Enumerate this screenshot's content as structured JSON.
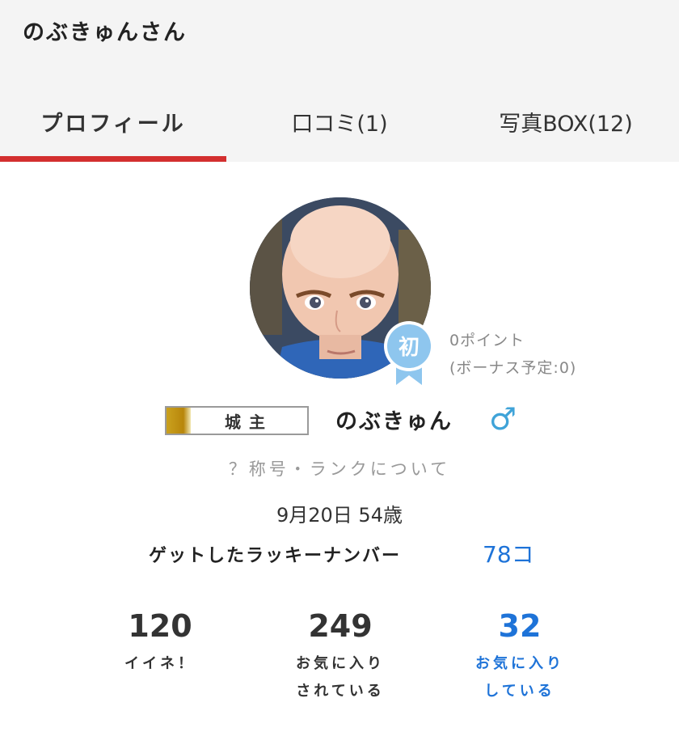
{
  "header": {
    "title": "のぶきゅんさん"
  },
  "tabs": [
    {
      "label": "プロフィール",
      "active": true
    },
    {
      "label": "口コミ(1)"
    },
    {
      "label": "写真BOX(12)"
    }
  ],
  "colors": {
    "accent": "#d32f2f",
    "link": "#1e73d8",
    "gender": "#3fa3d8",
    "badge": "#8ec6ee"
  },
  "profile": {
    "badge_label": "初",
    "points": "0ポイント",
    "bonus": "(ボーナス予定:0)",
    "rank": "城主",
    "name": "のぶきゅん",
    "gender_symbol": "♂",
    "rank_about": "？称号・ランクについて",
    "birthday": "9月20日 54歳",
    "lucky_label": "ゲットしたラッキーナンバー",
    "lucky_count": "78コ"
  },
  "stats": [
    {
      "value": "120",
      "label": "イイネ！"
    },
    {
      "value": "249",
      "label": "お気に入り\nされている"
    },
    {
      "value": "32",
      "label": "お気に入り\nしている"
    }
  ]
}
